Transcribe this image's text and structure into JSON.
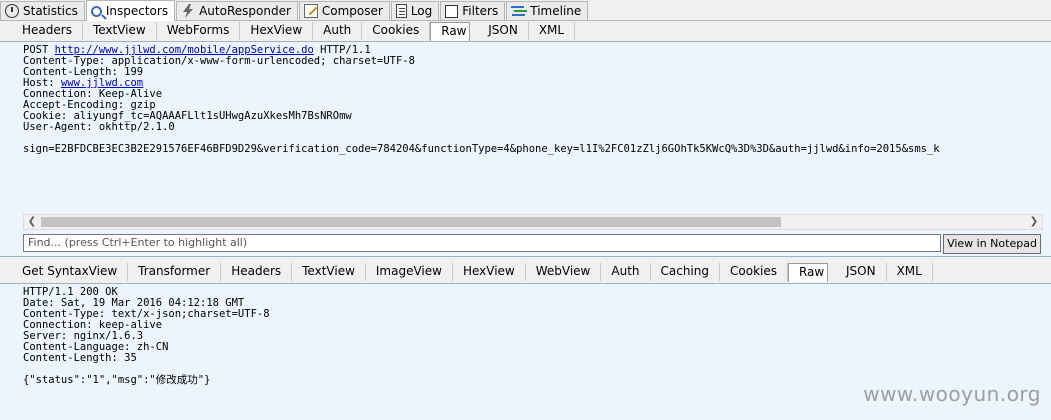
{
  "top_tabs": [
    {
      "label": "Statistics",
      "icon": "clock-icon"
    },
    {
      "label": "Inspectors",
      "icon": "magnifier-icon",
      "active": true
    },
    {
      "label": "AutoResponder",
      "icon": "lightning-icon"
    },
    {
      "label": "Composer",
      "icon": "compose-icon"
    },
    {
      "label": "Log",
      "icon": "log-icon"
    },
    {
      "label": "Filters",
      "icon": "checkbox-icon"
    },
    {
      "label": "Timeline",
      "icon": "timeline-icon"
    }
  ],
  "request_tabs": [
    "Headers",
    "TextView",
    "WebForms",
    "HexView",
    "Auth",
    "Cookies",
    "Raw",
    "JSON",
    "XML"
  ],
  "request_active_tab": "Raw",
  "request_raw": {
    "line1_method": "POST ",
    "line1_url": "http://www.jjlwd.com/mobile/appService.do",
    "line1_proto": " HTTP/1.1",
    "content_type": "Content-Type: application/x-www-form-urlencoded; charset=UTF-8",
    "content_length": "Content-Length: 199",
    "host_label": "Host: ",
    "host_value": "www.jjlwd.com",
    "connection": "Connection: Keep-Alive",
    "accept_encoding": "Accept-Encoding: gzip",
    "cookie": "Cookie: aliyungf_tc=AQAAAFLlt1sUHwgAzuXkesMh7BsNROmw",
    "user_agent": "User-Agent: okhttp/2.1.0",
    "body": "sign=E2BFDCBE3EC3B2E291576EF46BFD9D29&verification_code=784204&functionType=4&phone_key=l1I%2FC01zZlj6GOhTk5KWcQ%3D%3D&auth=jjlwd&info=2015&sms_k"
  },
  "find_placeholder": "Find... (press Ctrl+Enter to highlight all)",
  "view_in_notepad_label": "View in Notepad",
  "response_tabs": [
    "Get SyntaxView",
    "Transformer",
    "Headers",
    "TextView",
    "ImageView",
    "HexView",
    "WebView",
    "Auth",
    "Caching",
    "Cookies",
    "Raw",
    "JSON",
    "XML"
  ],
  "response_active_tab": "Raw",
  "response_raw": [
    "HTTP/1.1 200 OK",
    "Date: Sat, 19 Mar 2016 04:12:18 GMT",
    "Content-Type: text/x-json;charset=UTF-8",
    "Connection: keep-alive",
    "Server: nginx/1.6.3",
    "Content-Language: zh-CN",
    "Content-Length: 35",
    "",
    "{\"status\":\"1\",\"msg\":\"修改成功\"}"
  ],
  "watermark": "www.wooyun.org"
}
